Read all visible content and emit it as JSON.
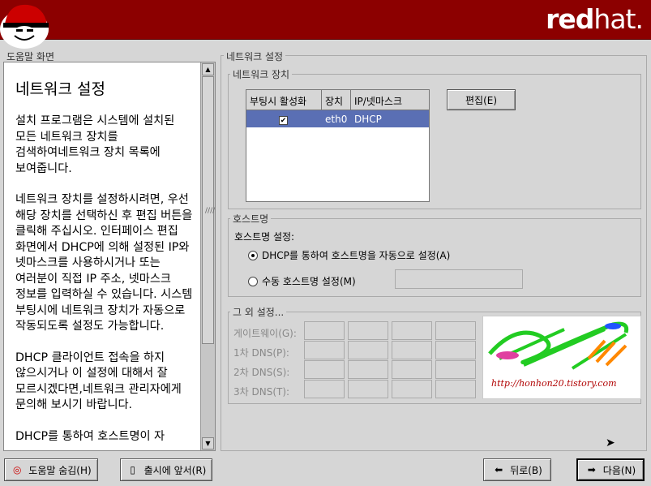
{
  "brand": {
    "bold": "red",
    "rest": "hat."
  },
  "help": {
    "frame_title": "도움말 화면",
    "heading": "네트워크 설정",
    "paragraphs": [
      "설치 프로그램은 시스템에 설치된 모든 네트워크 장치를 검색하여네트워크 장치 목록에 보여줍니다.",
      "네트워크 장치를 설정하시려면, 우선 해당 장치를 선택하신 후 편집 버튼을 클릭해 주십시오. 인터페이스 편집 화면에서 DHCP에 의해 설정된 IP와 넷마스크를 사용하시거나 또는 여러분이 직접 IP 주소, 넷마스크 정보를 입력하실 수 있습니다. 시스템 부팅시에 네트워크 장치가 자동으로 작동되도록 설정도 가능합니다.",
      "DHCP 클라이언트 접속을 하지 않으시거나 이 설정에 대해서 잘 모르시겠다면,네트워크 관리자에게 문의해 보시기 바랍니다.",
      "DHCP를 통하여 호스트명이 자"
    ]
  },
  "network": {
    "frame_title": "네트워크 설정",
    "devices_title": "네트워크 장치",
    "columns": [
      "부팅시 활성화",
      "장치",
      "IP/넷마스크"
    ],
    "rows": [
      {
        "active": "✔",
        "device": "eth0",
        "ip": "DHCP"
      }
    ],
    "edit_button": "편집(E)"
  },
  "hostname": {
    "section_title": "호스트명",
    "setting_label": "호스트명 설정:",
    "dhcp_option": "DHCP를 통하여 호스트명을 자동으로 설정(A)",
    "manual_option": "수동 호스트명 설정(M)",
    "selected": "dhcp"
  },
  "misc": {
    "section_title": "그 외 설정...",
    "gateway_label": "게이트웨이(G):",
    "dns1_label": "1차 DNS(P):",
    "dns2_label": "2차 DNS(S):",
    "dns3_label": "3차 DNS(T):",
    "watermark_url": "http://honhon20.tistory.com"
  },
  "buttons": {
    "hide_help": "도움말 숨김(H)",
    "release_notes": "출시에 앞서(R)",
    "back": "뒤로(B)",
    "next": "다음(N)"
  },
  "colors": {
    "topbar": "#8c0000",
    "selection": "#5a6fb4"
  }
}
